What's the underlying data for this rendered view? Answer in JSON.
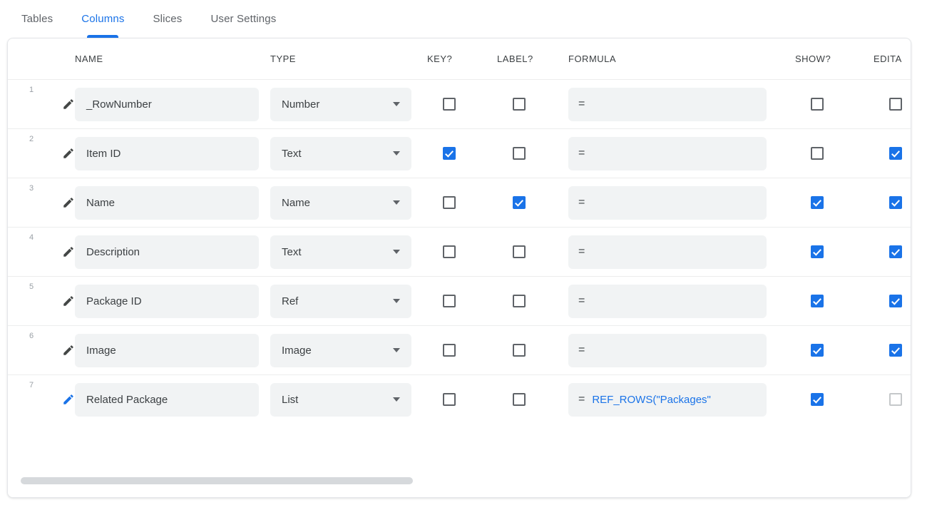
{
  "tabs": [
    {
      "label": "Tables",
      "active": false
    },
    {
      "label": "Columns",
      "active": true
    },
    {
      "label": "Slices",
      "active": false
    },
    {
      "label": "User Settings",
      "active": false
    }
  ],
  "table": {
    "headers": {
      "name": "NAME",
      "type": "TYPE",
      "key": "KEY?",
      "label": "LABEL?",
      "formula": "FORMULA",
      "show": "SHOW?",
      "editable": "EDITA"
    },
    "equals_symbol": "=",
    "rows": [
      {
        "index": "1",
        "name": "_RowNumber",
        "type": "Number",
        "key": false,
        "label": false,
        "formula": "",
        "show": false,
        "editable": false,
        "editable_disabled": false,
        "pencil_active": false
      },
      {
        "index": "2",
        "name": "Item ID",
        "type": "Text",
        "key": true,
        "label": false,
        "formula": "",
        "show": false,
        "editable": true,
        "editable_disabled": false,
        "pencil_active": false
      },
      {
        "index": "3",
        "name": "Name",
        "type": "Name",
        "key": false,
        "label": true,
        "formula": "",
        "show": true,
        "editable": true,
        "editable_disabled": false,
        "pencil_active": false
      },
      {
        "index": "4",
        "name": "Description",
        "type": "Text",
        "key": false,
        "label": false,
        "formula": "",
        "show": true,
        "editable": true,
        "editable_disabled": false,
        "pencil_active": false
      },
      {
        "index": "5",
        "name": "Package ID",
        "type": "Ref",
        "key": false,
        "label": false,
        "formula": "",
        "show": true,
        "editable": true,
        "editable_disabled": false,
        "pencil_active": false
      },
      {
        "index": "6",
        "name": "Image",
        "type": "Image",
        "key": false,
        "label": false,
        "formula": "",
        "show": true,
        "editable": true,
        "editable_disabled": false,
        "pencil_active": false
      },
      {
        "index": "7",
        "name": "Related Package",
        "type": "List",
        "key": false,
        "label": false,
        "formula": "REF_ROWS(\"Packages\"",
        "show": true,
        "editable": false,
        "editable_disabled": true,
        "pencil_active": true
      }
    ]
  },
  "colors": {
    "accent": "#1a73e8",
    "text": "#3c4043",
    "muted": "#5f6368",
    "field_bg": "#f1f3f4",
    "row_divider": "#eceded",
    "scrollbar": "#d6d9dc"
  },
  "icons": {
    "pencil": "pencil-icon",
    "caret": "chevron-down-icon"
  }
}
